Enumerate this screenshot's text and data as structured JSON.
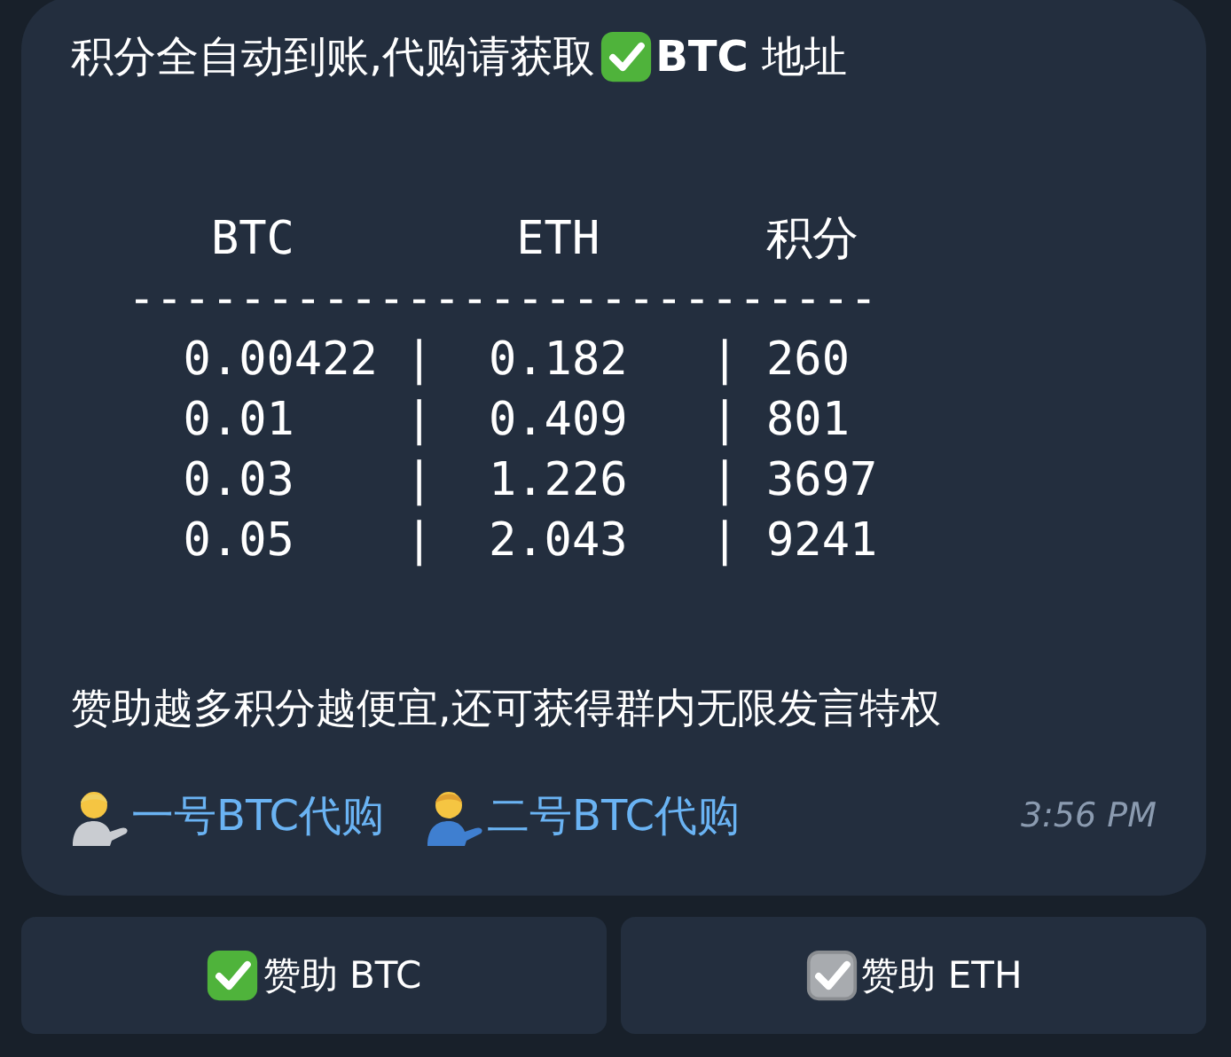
{
  "message": {
    "title_before": "积分全自动到账,代购请获取",
    "title_after": "**BTC** 地址",
    "code_lines": [
      "   BTC        ETH      积分",
      "---------------------------",
      "  0.00422 |  0.182   | 260",
      "  0.01    |  0.409   | 801",
      "  0.03    |  1.226   | 3697",
      "  0.05    |  2.043   | 9241"
    ],
    "note": "赞助越多积分越便宜,还可获得群内无限发言特权",
    "links": [
      {
        "label": "一号BTC代购",
        "color": "#c9ccd1"
      },
      {
        "label": "二号BTC代购",
        "color": "#3f7fd0"
      }
    ],
    "time": "3:56 PM"
  },
  "buttons": [
    {
      "label": "赞助 BTC",
      "kind": "green_check"
    },
    {
      "label": "赞助 ETH",
      "kind": "grey_check"
    }
  ]
}
